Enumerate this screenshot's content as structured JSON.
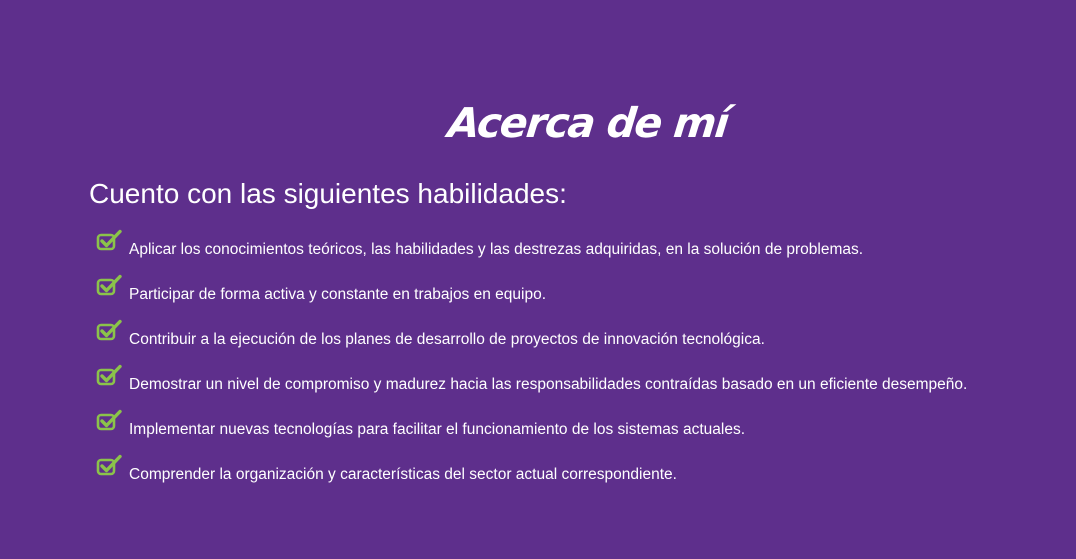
{
  "about": {
    "title": "Acerca de mí",
    "subtitle": "Cuento con las siguientes habilidades:",
    "skills": [
      "Aplicar los conocimientos teóricos, las habilidades y las destrezas adquiridas, en la solución de problemas.",
      "Participar de forma activa y constante en trabajos en equipo.",
      "Contribuir a la ejecución de los planes de desarrollo de proyectos de innovación tecnológica.",
      "Demostrar un nivel de compromiso y madurez hacia las responsabilidades contraídas basado en un eficiente desempeño.",
      "Implementar nuevas tecnologías para facilitar el funcionamiento de los sistemas actuales.",
      "Comprender la organización y características del sector actual correspondiente."
    ]
  },
  "colors": {
    "background": "#5e2f8c",
    "text": "#ffffff",
    "check": "#8bc34a"
  },
  "icons": {
    "skill_bullet": "checkbox-checked-icon"
  }
}
